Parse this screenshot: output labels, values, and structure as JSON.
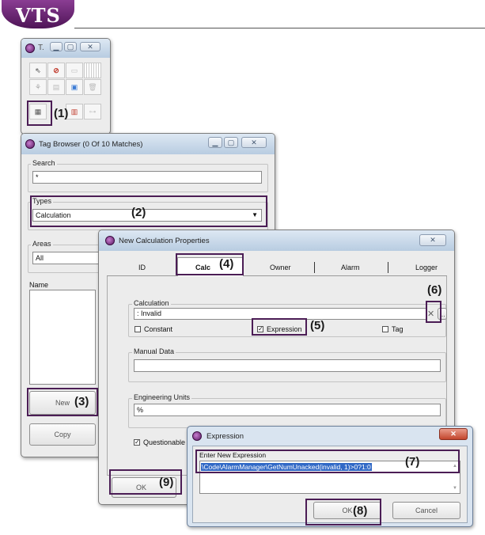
{
  "logo": {
    "text": "VTS"
  },
  "toolbox": {
    "title": "T."
  },
  "tag_browser": {
    "title": "Tag Browser (0 Of 10 Matches)",
    "search_label": "Search",
    "search_value": "*",
    "types_label": "Types",
    "types_value": "Calculation",
    "areas_label": "Areas",
    "areas_value": "All",
    "name_header": "Name",
    "new_button": "New",
    "copy_button": "Copy"
  },
  "calc_props": {
    "title": "New Calculation Properties",
    "tabs": [
      "ID",
      "Calc",
      "Owner",
      "Alarm",
      "Logger"
    ],
    "calculation_label": "Calculation",
    "calculation_value": ": Invalid",
    "constant_label": "Constant",
    "expression_label": "Expression",
    "tag_label": "Tag",
    "manual_data_label": "Manual Data",
    "eng_units_label": "Engineering Units",
    "eng_units_value": "%",
    "questionable_label": "Questionable",
    "browse_label": "...",
    "ok_button": "OK"
  },
  "expression": {
    "title": "Expression",
    "enter_label": "Enter New Expression",
    "value": "\\Code\\AlarmManager\\GetNumUnacked(invalid, 1)>0?1:0",
    "ok_button": "OK",
    "cancel_button": "Cancel"
  },
  "callouts": {
    "c1": "(1)",
    "c2": "(2)",
    "c3": "(3)",
    "c4": "(4)",
    "c5": "(5)",
    "c6": "(6)",
    "c7": "(7)",
    "c8": "(8)",
    "c9": "(9)"
  }
}
